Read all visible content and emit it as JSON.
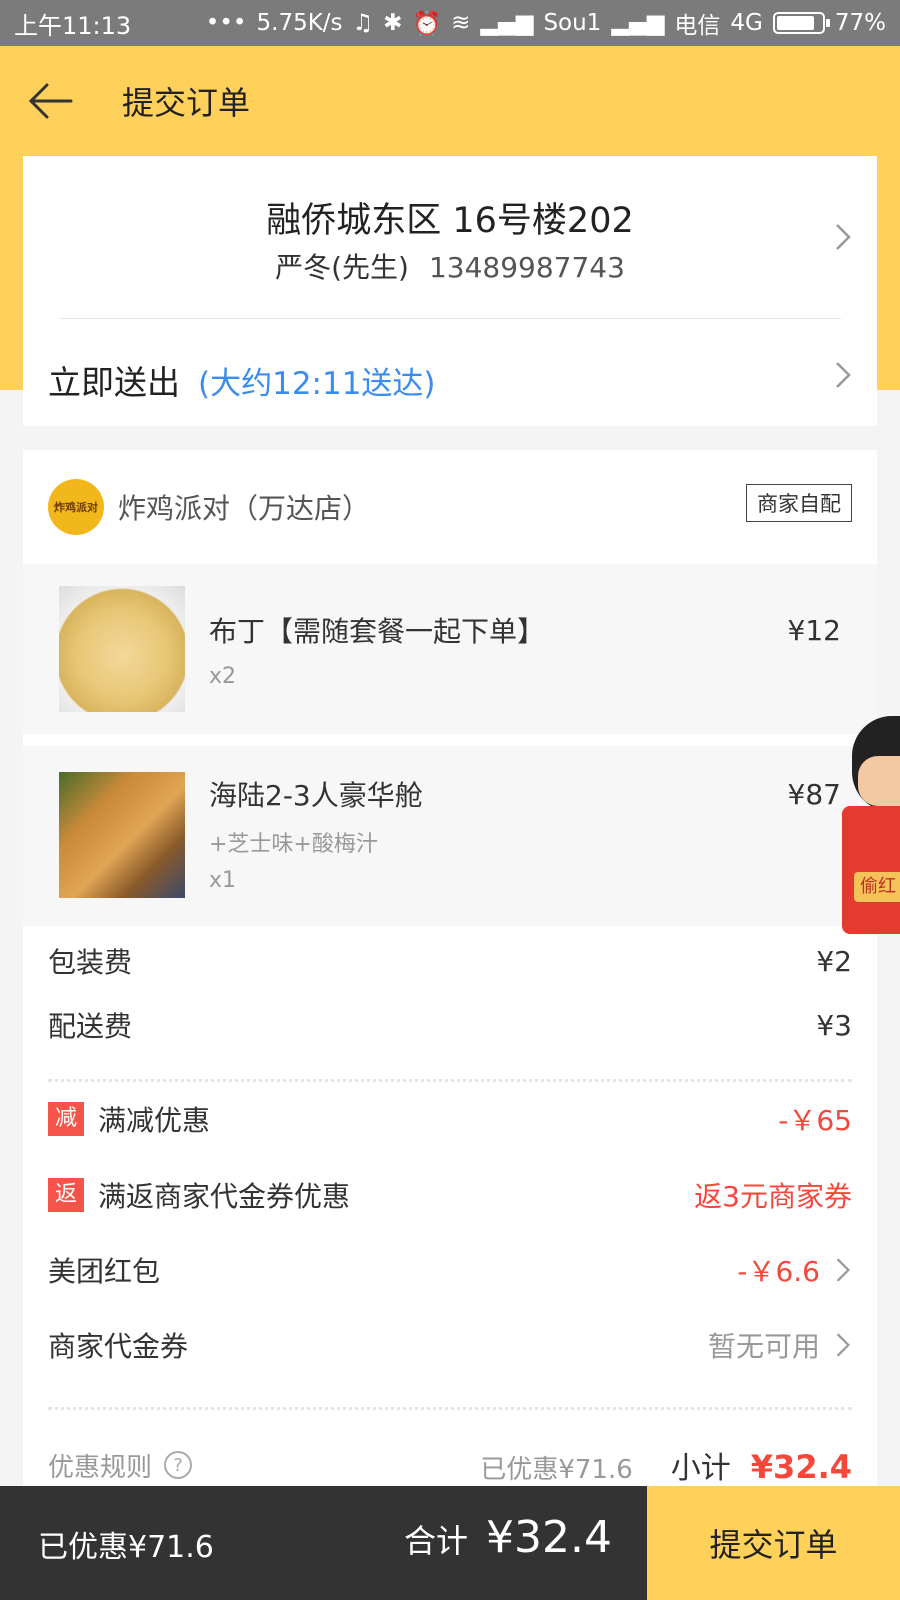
{
  "status_bar": {
    "time": "上午11:13",
    "speed": "5.75K/s",
    "carrier1": "Sou1",
    "carrier2": "电信",
    "network": "4G",
    "battery": "77%"
  },
  "header": {
    "title": "提交订单"
  },
  "address": {
    "location": "融侨城东区 16号楼202",
    "name": "严冬(先生)",
    "phone": "13489987743"
  },
  "delivery": {
    "label": "立即送出",
    "eta": "(大约12:11送达)"
  },
  "shop": {
    "logo_text": "炸鸡派对",
    "name": "炸鸡派对（万达店）",
    "tag": "商家自配"
  },
  "items": [
    {
      "name": "布丁【需随套餐一起下单】",
      "options": "",
      "qty": "x2",
      "price": "¥12"
    },
    {
      "name": "海陆2-3人豪华舱",
      "options": "+芝士味+酸梅汁",
      "qty": "x1",
      "price": "¥87"
    }
  ],
  "fees": {
    "packaging_label": "包装费",
    "packaging_value": "¥2",
    "delivery_label": "配送费",
    "delivery_value": "¥3"
  },
  "discounts": {
    "full_reduce_badge": "减",
    "full_reduce_label": "满减优惠",
    "full_reduce_value": "-￥65",
    "voucher_back_badge": "返",
    "voucher_back_label": "满返商家代金券优惠",
    "voucher_back_value": "返3元商家券",
    "redpacket_label": "美团红包",
    "redpacket_value": "-￥6.6",
    "merchant_voucher_label": "商家代金券",
    "merchant_voucher_value": "暂无可用"
  },
  "summary": {
    "rules_label": "优惠规则",
    "help_icon_text": "?",
    "discounted": "已优惠¥71.6",
    "subtotal_label": "小计",
    "subtotal_value": "¥32.4"
  },
  "bottom_bar": {
    "saved": "已优惠¥71.6",
    "total_label": "合计",
    "total_value": "¥32.4",
    "submit_label": "提交订单"
  },
  "float_widget": {
    "label": "偷红"
  },
  "colors": {
    "brand_yellow": "#ffd05a",
    "accent_red": "#f5483b",
    "link_blue": "#3b8cf0",
    "bottom_bar": "#333333"
  }
}
